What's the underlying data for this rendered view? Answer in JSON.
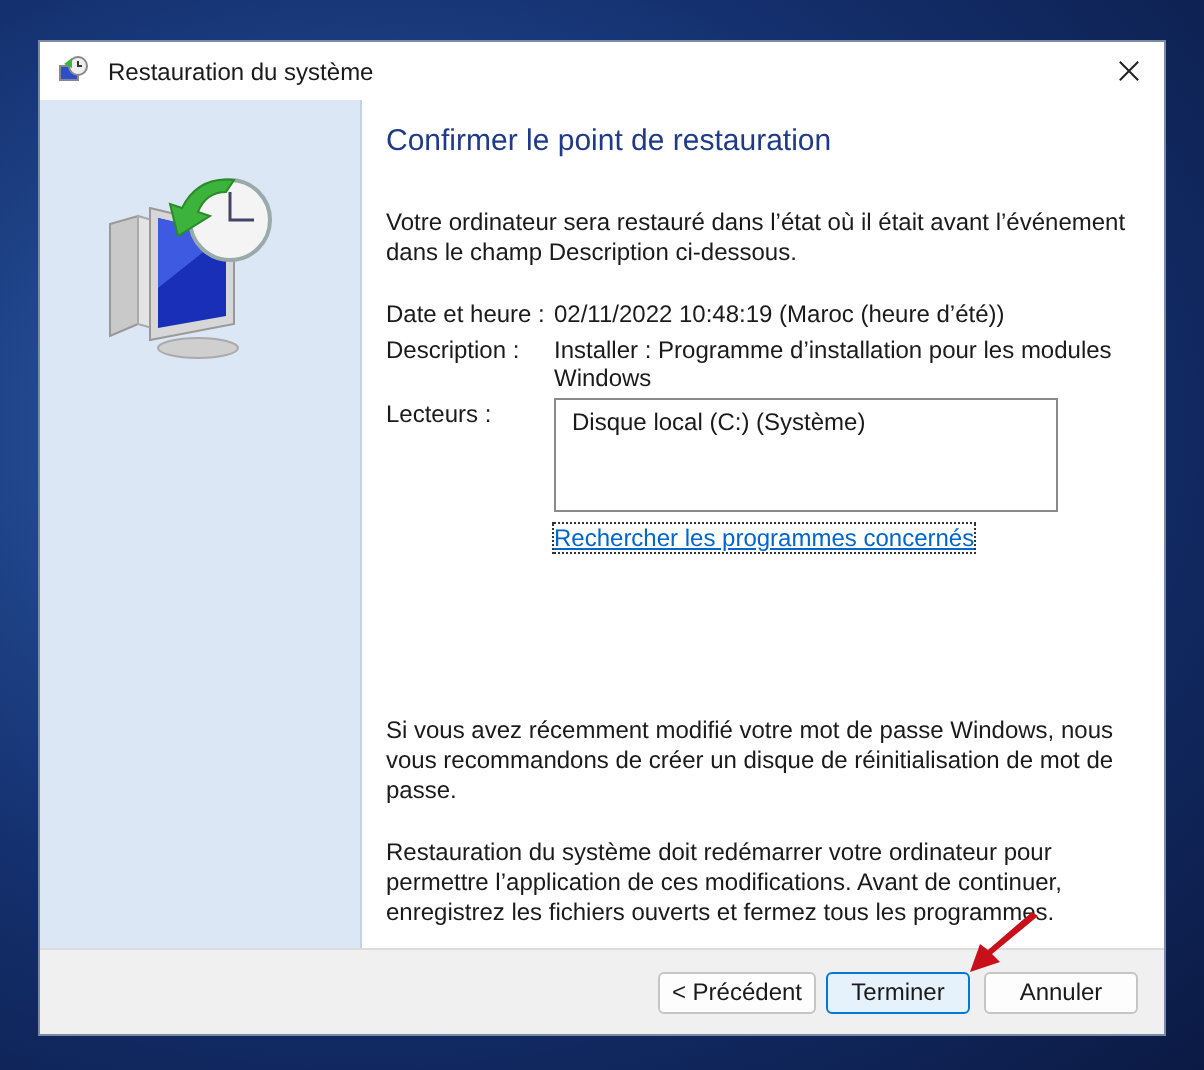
{
  "window": {
    "title": "Restauration du système"
  },
  "heading": "Confirmer le point de restauration",
  "intro": "Votre ordinateur sera restauré dans l’état où il était avant l’événement dans le champ Description ci-dessous.",
  "details": [
    {
      "label": "Date et heure :",
      "value": "02/11/2022 10:48:19 (Maroc (heure d’été))"
    },
    {
      "label": "Description :",
      "value": "Installer : Programme d’installation pour les modules Windows"
    }
  ],
  "drives": {
    "label": "Lecteurs :",
    "items": [
      "Disque local (C:) (Système)"
    ]
  },
  "link": "Rechercher les programmes concernés",
  "notes": [
    "Si vous avez récemment modifié votre mot de passe Windows, nous vous recommandons de créer un disque de réinitialisation de mot de passe.",
    "Restauration du système doit redémarrer votre ordinateur pour permettre l’application de ces modifications. Avant de continuer, enregistrez les fichiers ouverts et fermez tous les programmes."
  ],
  "buttons": [
    {
      "label": "< Précédent",
      "default": false
    },
    {
      "label": "Terminer",
      "default": true
    },
    {
      "label": "Annuler",
      "default": false
    }
  ]
}
